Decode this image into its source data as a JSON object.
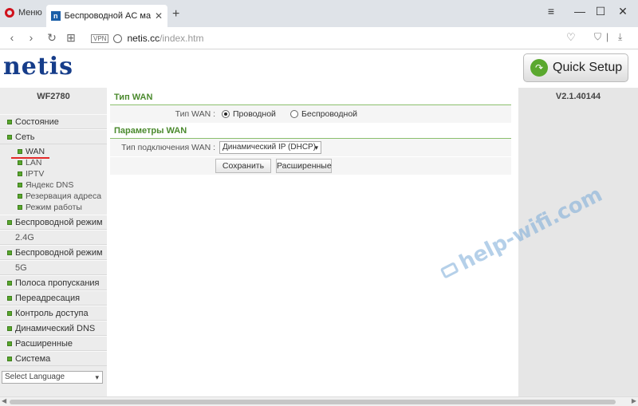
{
  "browser": {
    "menu_label": "Меню",
    "tab_title": "Беспроводной AC маршр",
    "tab_favicon": "n",
    "url_host": "netis.cc",
    "url_path": "/index.htm",
    "vpn_label": "VPN"
  },
  "header": {
    "logo_text": "netis",
    "quick_setup": "Quick Setup"
  },
  "sidebar": {
    "model": "WF2780",
    "items": [
      {
        "label": "Состояние"
      },
      {
        "label": "Сеть"
      },
      {
        "label": "WAN"
      },
      {
        "label": "LAN"
      },
      {
        "label": "IPTV"
      },
      {
        "label": "Яндекс DNS"
      },
      {
        "label": "Резервация адреса"
      },
      {
        "label": "Режим работы"
      },
      {
        "label": "Беспроводной режим"
      },
      {
        "label": "2.4G"
      },
      {
        "label": "Беспроводной режим"
      },
      {
        "label": "5G"
      },
      {
        "label": "Полоса пропускания"
      },
      {
        "label": "Переадресация"
      },
      {
        "label": "Контроль доступа"
      },
      {
        "label": "Динамический DNS"
      },
      {
        "label": "Расширенные"
      },
      {
        "label": "Система"
      }
    ],
    "language_select": "Select Language"
  },
  "content": {
    "wan_type_title": "Тип WAN",
    "wan_type_label": "Тип WAN :",
    "wan_option_wired": "Проводной",
    "wan_option_wireless": "Беспроводной",
    "wan_params_title": "Параметры WAN",
    "connection_type_label": "Тип подключения WAN :",
    "connection_type_value": "Динамический IP (DHCP)",
    "save_button": "Сохранить",
    "advanced_button": "Расширенные"
  },
  "version": "V2.1.40144",
  "watermark": "help-wifi.com",
  "colors": {
    "accent_green": "#4b8a2e",
    "logo_blue": "#163d8a",
    "active_underline": "#e32a2a"
  }
}
